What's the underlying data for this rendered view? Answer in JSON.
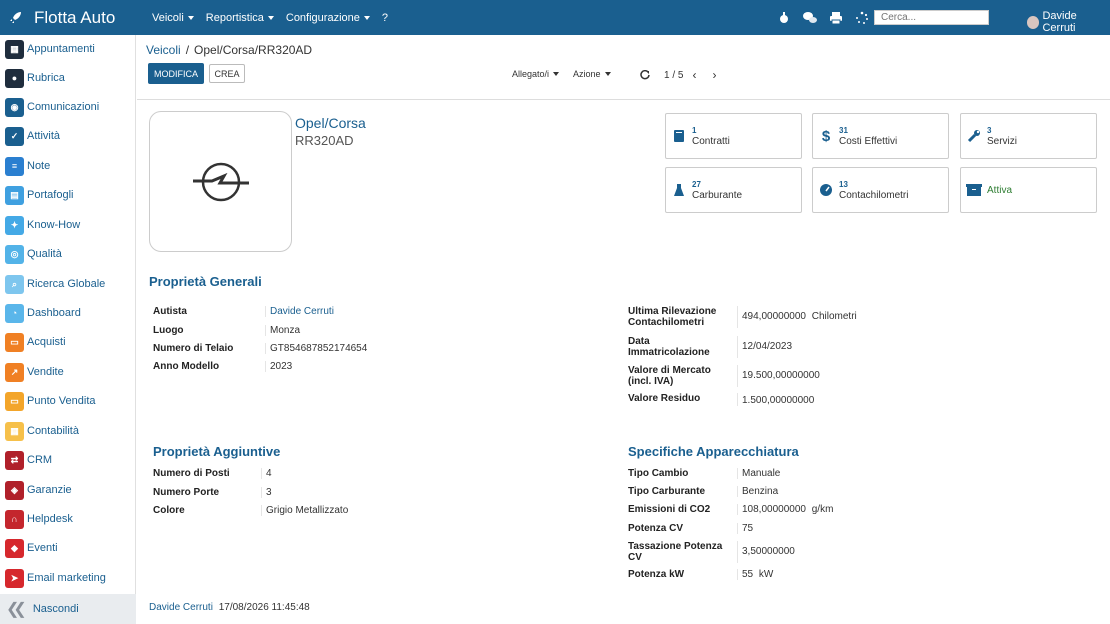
{
  "app": {
    "title": "Flotta Auto"
  },
  "topnav": {
    "items": [
      {
        "label": "Veicoli"
      },
      {
        "label": "Reportistica"
      },
      {
        "label": "Configurazione"
      },
      {
        "label": "?"
      }
    ],
    "search_placeholder": "Cerca...",
    "user": "Davide Cerruti"
  },
  "sidebar": {
    "items": [
      {
        "label": "Appuntamenti",
        "color": "#1f2d3d"
      },
      {
        "label": "Rubrica",
        "color": "#1f2d3d"
      },
      {
        "label": "Comunicazioni",
        "color": "#1a5f8f"
      },
      {
        "label": "Attività",
        "color": "#1a5f8f"
      },
      {
        "label": "Note",
        "color": "#2a7fd0"
      },
      {
        "label": "Portafogli",
        "color": "#3fa0e0"
      },
      {
        "label": "Know-How",
        "color": "#44a9e6"
      },
      {
        "label": "Qualità",
        "color": "#53b3e8"
      },
      {
        "label": "Ricerca Globale",
        "color": "#7ec6ee"
      },
      {
        "label": "Dashboard",
        "color": "#5ab6ea"
      },
      {
        "label": "Acquisti",
        "color": "#f08024"
      },
      {
        "label": "Vendite",
        "color": "#f08024"
      },
      {
        "label": "Punto Vendita",
        "color": "#f3a52a"
      },
      {
        "label": "Contabilità",
        "color": "#f6c04a"
      },
      {
        "label": "CRM",
        "color": "#b0202a"
      },
      {
        "label": "Garanzie",
        "color": "#b0202a"
      },
      {
        "label": "Helpdesk",
        "color": "#c4262d"
      },
      {
        "label": "Eventi",
        "color": "#d6282d"
      },
      {
        "label": "Email marketing",
        "color": "#d6282d"
      }
    ],
    "hide_label": "Nascondi"
  },
  "breadcrumb": {
    "parent": "Veicoli",
    "separator": "/",
    "current": "Opel/Corsa/RR320AD"
  },
  "toolbar": {
    "edit_label": "MODIFICA",
    "create_label": "CREA",
    "attachments_label": "Allegato/i",
    "action_label": "Azione",
    "pager": "1 / 5"
  },
  "vehicle": {
    "model": "Opel/Corsa",
    "plate": "RR320AD"
  },
  "smart_buttons": [
    {
      "count": "1",
      "label": "Contratti",
      "icon": "book-icon"
    },
    {
      "count": "31",
      "label": "Costi Effettivi",
      "icon": "dollar-icon"
    },
    {
      "count": "3",
      "label": "Servizi",
      "icon": "wrench-icon"
    },
    {
      "count": "27",
      "label": "Carburante",
      "icon": "flask-icon"
    },
    {
      "count": "13",
      "label": "Contachilometri",
      "icon": "tachometer-icon"
    },
    {
      "count": "",
      "label": "Attiva",
      "icon": "archive-icon"
    }
  ],
  "general": {
    "title": "Proprietà Generali",
    "left": [
      {
        "k": "Autista",
        "v": "Davide Cerruti"
      },
      {
        "k": "Luogo",
        "v": "Monza"
      },
      {
        "k": "Numero di Telaio",
        "v": "GT854687852174654"
      },
      {
        "k": "Anno Modello",
        "v": "2023"
      }
    ],
    "right": [
      {
        "k1": "Ultima Rilevazione",
        "k2": "Contachilometri",
        "v": "494,00000000",
        "unit": "Chilometri"
      },
      {
        "k1": "Data",
        "k2": "Immatricolazione",
        "v": "12/04/2023"
      },
      {
        "k1": "Valore di Mercato",
        "k2": "(incl. IVA)",
        "v": "19.500,00000000"
      },
      {
        "k1": "Valore Residuo",
        "v": "1.500,00000000"
      }
    ]
  },
  "additional": {
    "title": "Proprietà Aggiuntive",
    "rows": [
      {
        "k": "Numero di Posti",
        "v": "4"
      },
      {
        "k": "Numero Porte",
        "v": "3"
      },
      {
        "k": "Colore",
        "v": "Grigio Metallizzato"
      }
    ]
  },
  "equipment": {
    "title": "Specifiche Apparecchiatura",
    "rows": [
      {
        "k1": "Tipo Cambio",
        "v": "Manuale"
      },
      {
        "k1": "Tipo Carburante",
        "v": "Benzina"
      },
      {
        "k1": "Emissioni di CO2",
        "v": "108,00000000",
        "unit": "g/km"
      },
      {
        "k1": "Potenza CV",
        "v": "75"
      },
      {
        "k1": "Tassazione Potenza",
        "k2": "CV",
        "v": "3,50000000"
      },
      {
        "k1": "Potenza kW",
        "v": "55",
        "unit": "kW"
      }
    ]
  },
  "footer": {
    "user": "Davide Cerruti",
    "date": "17/08/2026 11:45:48"
  }
}
